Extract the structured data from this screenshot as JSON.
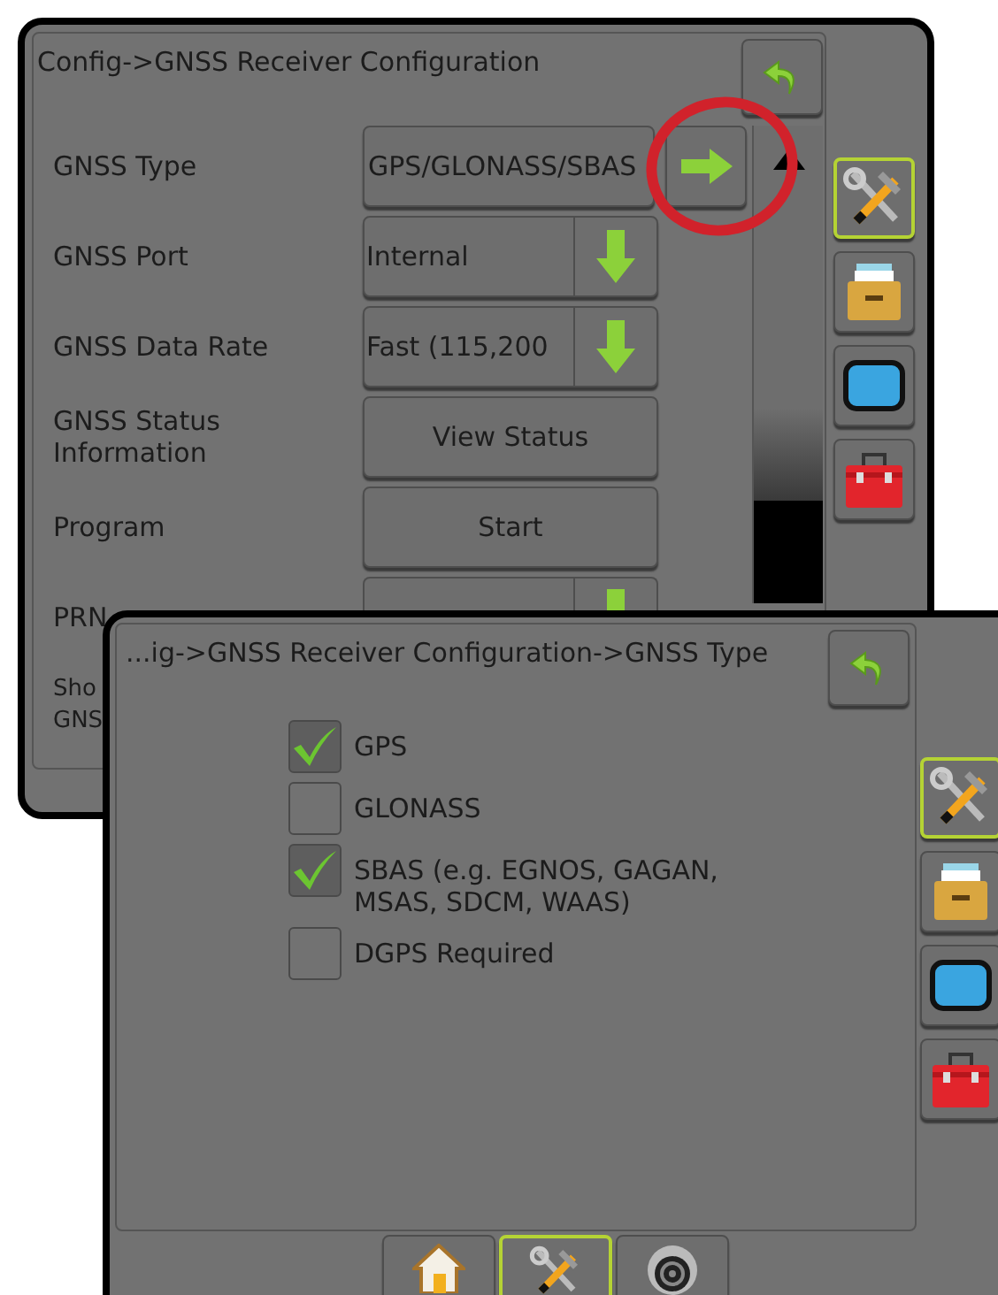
{
  "back_screen": {
    "title": "Config->GNSS Receiver Configuration",
    "rows": [
      {
        "kind": "next",
        "label": "GNSS Type",
        "value": "GPS/GLONASS/SBAS",
        "highlighted": true
      },
      {
        "kind": "dropdown",
        "label": "GNSS Port",
        "value": "Internal"
      },
      {
        "kind": "dropdown",
        "label": "GNSS Data Rate",
        "value": "Fast (115,200"
      },
      {
        "kind": "button",
        "label": "GNSS Status Information",
        "value": "View Status"
      },
      {
        "kind": "button",
        "label": "Program",
        "value": "Start"
      },
      {
        "kind": "dropdown",
        "label": "PRN"
      },
      {
        "kind": "label",
        "label": "Sho",
        "label_2": "GNS"
      }
    ],
    "side_tabs": [
      {
        "kind": "tools",
        "selected": true
      },
      {
        "kind": "storage",
        "selected": false
      },
      {
        "kind": "display",
        "selected": false
      },
      {
        "kind": "toolbox",
        "selected": false
      }
    ]
  },
  "front_screen": {
    "title": "...ig->GNSS Receiver Configuration->GNSS Type",
    "options": [
      {
        "label": "GPS",
        "checked": true
      },
      {
        "label": "GLONASS",
        "checked": false
      },
      {
        "label": "SBAS (e.g. EGNOS, GAGAN, MSAS, SDCM, WAAS)",
        "checked": true
      },
      {
        "label": "DGPS Required",
        "checked": false
      }
    ],
    "side_tabs": [
      {
        "kind": "tools",
        "selected": true
      },
      {
        "kind": "storage",
        "selected": false
      },
      {
        "kind": "display",
        "selected": false
      },
      {
        "kind": "toolbox",
        "selected": false
      }
    ],
    "bottom_tabs": [
      {
        "kind": "home",
        "selected": false
      },
      {
        "kind": "tools",
        "selected": true
      },
      {
        "kind": "camera",
        "selected": false
      }
    ]
  }
}
